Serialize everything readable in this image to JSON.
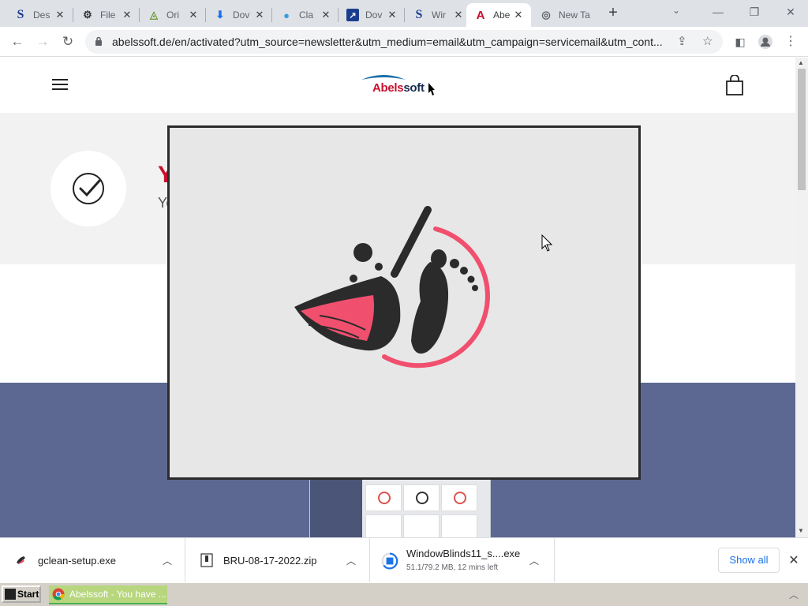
{
  "browser": {
    "tabs": [
      {
        "label": "Des",
        "favicon": "S",
        "favicon_color": "#1a3d8f"
      },
      {
        "label": "File",
        "favicon": "gear-icon",
        "favicon_color": "#333"
      },
      {
        "label": "Ori",
        "favicon": "triangle-icon",
        "favicon_color": "#6a9b2f"
      },
      {
        "label": "Dov",
        "favicon": "download-icon",
        "favicon_color": "#1a73e8"
      },
      {
        "label": "Cla",
        "favicon": "globe-icon",
        "favicon_color": "#3aa0d8"
      },
      {
        "label": "Dov",
        "favicon": "box-icon",
        "favicon_color": "#1a3d8f"
      },
      {
        "label": "Wir",
        "favicon": "S",
        "favicon_color": "#1a3d8f"
      },
      {
        "label": "Abe",
        "favicon": "A",
        "favicon_color": "#c8102e",
        "active": true
      },
      {
        "label": "New Tab",
        "favicon": "chrome-icon",
        "favicon_color": "#5f6368"
      }
    ],
    "url": "abelssoft.de/en/activated?utm_source=newsletter&utm_medium=email&utm_campaign=servicemail&utm_cont..."
  },
  "site": {
    "logo": {
      "part1": "Abels",
      "part2": "soft"
    },
    "hero_title": "You have successfully activated",
    "hero_subtitle": "Yo"
  },
  "downloads": [
    {
      "name": "gclean-setup.exe",
      "status": ""
    },
    {
      "name": "BRU-08-17-2022.zip",
      "status": ""
    },
    {
      "name": "WindowBlinds11_s....exe",
      "status": "51.1/79.2 MB, 12 mins left"
    }
  ],
  "download_shelf": {
    "show_all": "Show all"
  },
  "taskbar": {
    "start": "Start",
    "task_label": "Abelssoft - You have ..."
  },
  "colors": {
    "brand_red": "#c8102e",
    "brand_navy": "#1a2b52",
    "band_blue": "#5c6891",
    "logo_coral": "#f0506e"
  }
}
